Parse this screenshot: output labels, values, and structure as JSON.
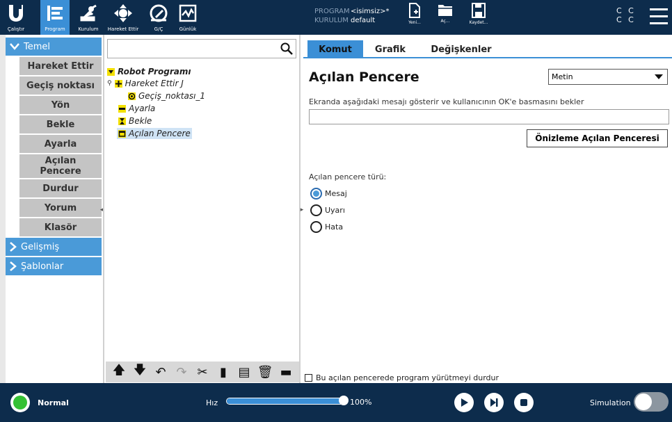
{
  "topbar": {
    "nav": [
      {
        "label": "Çalıştır",
        "icon": "ur-logo-icon"
      },
      {
        "label": "Program",
        "icon": "program-icon"
      },
      {
        "label": "Kurulum",
        "icon": "robot-arm-icon"
      },
      {
        "label": "Hareket Ettir",
        "icon": "move-arrows-icon"
      },
      {
        "label": "G/Ç",
        "icon": "io-gauge-icon"
      },
      {
        "label": "Günlük",
        "icon": "log-chart-icon"
      }
    ],
    "program_key": "PROGRAM",
    "program_value": "<isimsiz>*",
    "installation_key": "KURULUM",
    "installation_value": "default",
    "file_buttons": [
      {
        "label": "Yeni...",
        "icon": "new-file-icon"
      },
      {
        "label": "Aç...",
        "icon": "open-folder-icon"
      },
      {
        "label": "Kaydet...",
        "icon": "save-disk-icon"
      }
    ],
    "cc_line1": "C C",
    "cc_line2": "C C"
  },
  "left": {
    "sections": [
      {
        "label": "Temel",
        "expanded": true
      },
      {
        "label": "Gelişmiş",
        "expanded": false
      },
      {
        "label": "Şablonlar",
        "expanded": false
      }
    ],
    "commands": [
      "Hareket Ettir",
      "Geçiş noktası",
      "Yön",
      "Bekle",
      "Ayarla",
      "Açılan Pencere",
      "Durdur",
      "Yorum",
      "Klasör"
    ]
  },
  "tree": {
    "search_value": "",
    "nodes": [
      {
        "label": "Robot Programı",
        "icon": "triangle-down-icon",
        "level": 0
      },
      {
        "label": "Hareket Ettir J",
        "icon": "move-icon",
        "level": 1
      },
      {
        "label": "Geçiş_noktası_1",
        "icon": "waypoint-icon",
        "level": 2
      },
      {
        "label": "Ayarla",
        "icon": "set-icon",
        "level": 1
      },
      {
        "label": "Bekle",
        "icon": "hourglass-icon",
        "level": 1
      },
      {
        "label": "Açılan Pencere",
        "icon": "popup-icon",
        "level": 1,
        "selected": true
      }
    ]
  },
  "right": {
    "tabs": [
      "Komut",
      "Grafik",
      "Değişkenler"
    ],
    "active_tab": "Komut",
    "title": "Açılan Pencere",
    "select_value": "Metin",
    "description": "Ekranda aşağıdaki mesajı gösterir ve kullanıcının OK'e basmasını bekler",
    "message_value": "",
    "preview_button": "Önizleme Açılan Penceresi",
    "popup_type_label": "Açılan pencere türü:",
    "popup_types": [
      "Mesaj",
      "Uyarı",
      "Hata"
    ],
    "selected_type": "Mesaj",
    "stop_checkbox_label": "Bu açılan pencerede program yürütmeyi durdur",
    "stop_checked": false
  },
  "bottombar": {
    "status": "Normal",
    "speed_label": "Hız",
    "speed_percent": "100%",
    "speed_fraction": 1.0,
    "simulation_label": "Simulation",
    "simulation_on": false
  },
  "colors": {
    "topbar_bg": "#0d2c4c",
    "accent": "#3b8fd6",
    "status_green": "#34c134"
  }
}
